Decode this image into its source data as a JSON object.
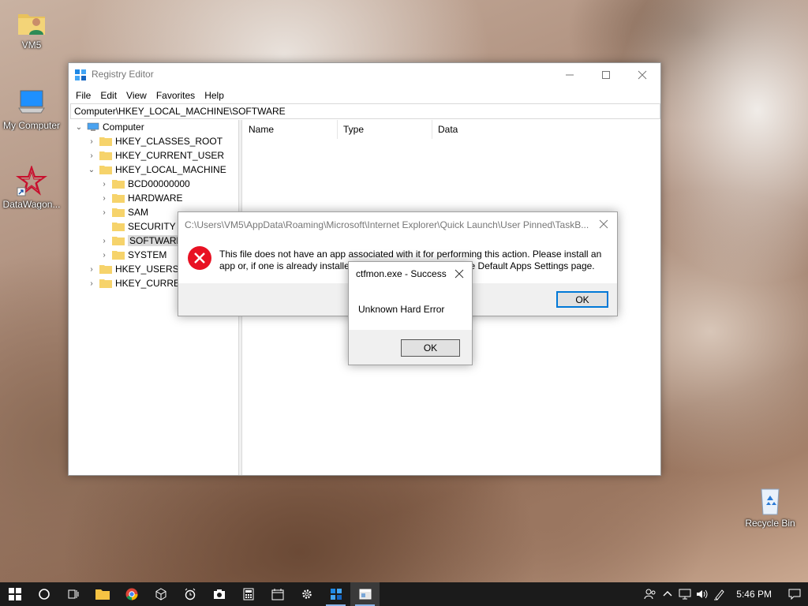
{
  "desktop": {
    "icons": [
      {
        "label": "VM5",
        "icon": "user-folder-icon"
      },
      {
        "label": "My Computer",
        "icon": "computer-icon"
      },
      {
        "label": "DataWagon...",
        "icon": "datawagon-shortcut-icon"
      },
      {
        "label": "Recycle Bin",
        "icon": "recycle-bin-icon"
      }
    ]
  },
  "regedit": {
    "title": "Registry Editor",
    "menu": [
      "File",
      "Edit",
      "View",
      "Favorites",
      "Help"
    ],
    "address": "Computer\\HKEY_LOCAL_MACHINE\\SOFTWARE",
    "tree": [
      {
        "label": "Computer",
        "level": 0,
        "expanded": true
      },
      {
        "label": "HKEY_CLASSES_ROOT",
        "level": 1,
        "expanded": false
      },
      {
        "label": "HKEY_CURRENT_USER",
        "level": 1,
        "expanded": false
      },
      {
        "label": "HKEY_LOCAL_MACHINE",
        "level": 1,
        "expanded": true
      },
      {
        "label": "BCD00000000",
        "level": 2,
        "expanded": false
      },
      {
        "label": "HARDWARE",
        "level": 2,
        "expanded": false
      },
      {
        "label": "SAM",
        "level": 2,
        "expanded": false
      },
      {
        "label": "SECURITY",
        "level": 2,
        "expanded": false
      },
      {
        "label": "SOFTWARE",
        "level": 2,
        "expanded": false,
        "selected": true
      },
      {
        "label": "SYSTEM",
        "level": 2,
        "expanded": false
      },
      {
        "label": "HKEY_USERS",
        "level": 1,
        "expanded": false
      },
      {
        "label": "HKEY_CURRENT_CONFIG",
        "level": 1,
        "expanded": false
      }
    ],
    "columns": [
      "Name",
      "Type",
      "Data"
    ]
  },
  "error_dialog": {
    "title": "C:\\Users\\VM5\\AppData\\Roaming\\Microsoft\\Internet Explorer\\Quick Launch\\User Pinned\\TaskB...",
    "message": "This file does not have an app associated with it for performing this action. Please install an app or, if one is already installed, create an association in the Default Apps Settings page.",
    "ok_label": "OK"
  },
  "success_dialog": {
    "title": "ctfmon.exe - Success",
    "message": "Unknown Hard Error",
    "ok_label": "OK"
  },
  "taskbar": {
    "items": [
      "start-icon",
      "cortana-icon",
      "task-view-icon",
      "file-explorer-icon",
      "chrome-icon",
      "3d-box-icon",
      "alarms-icon",
      "camera-icon",
      "calculator-icon",
      "calendar-icon",
      "settings-icon",
      "registry-editor-icon",
      "dialog-window-icon"
    ],
    "tray": [
      "people-icon",
      "chevron-up-icon",
      "network-icon",
      "volume-icon",
      "pen-icon"
    ],
    "clock": "5:46 PM",
    "notification_icon": "action-center-icon"
  },
  "colors": {
    "accent": "#0078d7",
    "error_red": "#e81123",
    "taskbar": "#1b1b1b"
  }
}
